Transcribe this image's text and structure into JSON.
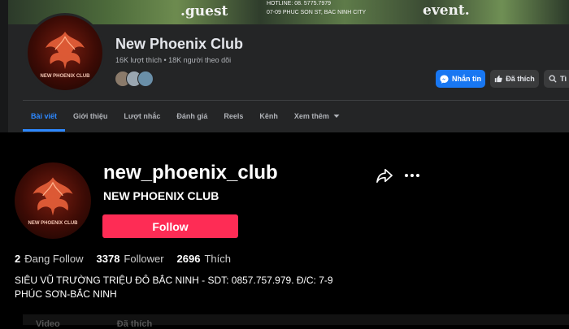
{
  "facebook": {
    "cover": {
      "guest_text": ".guest",
      "hotline_text": "HOTLINE: 08. 5775.7979",
      "address_text": "07-09 PHUC SON ST, BAC NINH CITY",
      "event_text": "event."
    },
    "avatar_logo_text": "NEW PHOENIX CLUB",
    "page_name": "New Phoenix Club",
    "stats": "16K lượt thích • 18K người theo dõi",
    "buttons": {
      "message": "Nhắn tin",
      "like": "Đã thích",
      "search": "Tì"
    },
    "tabs": [
      {
        "label": "Bài viết"
      },
      {
        "label": "Giới thiệu"
      },
      {
        "label": "Lượt nhắc"
      },
      {
        "label": "Đánh giá"
      },
      {
        "label": "Reels"
      },
      {
        "label": "Kênh"
      },
      {
        "label": "Xem thêm"
      }
    ],
    "colors": {
      "accent": "#2d88ff",
      "primary_button": "#1877f2"
    }
  },
  "tiktok": {
    "avatar_logo_text": "NEW PHOENIX CLUB",
    "username": "new_phoenix_club",
    "display_name": "NEW PHOENIX CLUB",
    "follow_label": "Follow",
    "stats": [
      {
        "value": "2",
        "label": "Đang Follow"
      },
      {
        "value": "3378",
        "label": "Follower"
      },
      {
        "value": "2696",
        "label": "Thích"
      }
    ],
    "bio": "SIÊU VŨ TRƯỜNG TRIỆU ĐÔ BẮC NINH - SDT: 0857.757.979. Đ/C: 7-9 PHÚC SƠN-BẮC NINH",
    "bottom_tabs": [
      "Video",
      "Đã thích"
    ],
    "colors": {
      "follow_button": "#fe2c55"
    }
  }
}
